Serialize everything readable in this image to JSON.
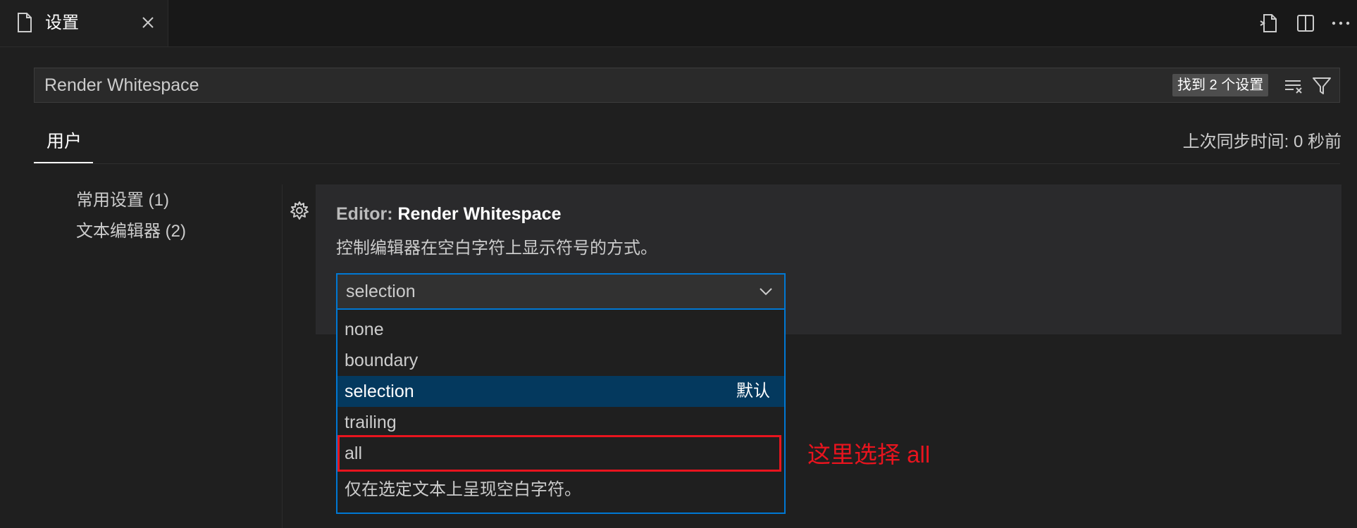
{
  "tab": {
    "title": "设置",
    "icon": "file-icon",
    "close_icon": "close-icon"
  },
  "toolbar": {
    "icons": [
      "open-settings-json-icon",
      "split-editor-icon",
      "more-actions-icon"
    ]
  },
  "search": {
    "value": "Render Whitespace",
    "badge": "找到 2 个设置",
    "icons": [
      "clear-filter-icon",
      "filter-icon"
    ]
  },
  "scope_tab": {
    "label": "用户"
  },
  "sync": {
    "text": "上次同步时间: 0 秒前"
  },
  "toc": {
    "items": [
      {
        "label": "常用设置 (1)"
      },
      {
        "label": "文本编辑器 (2)"
      }
    ]
  },
  "setting": {
    "category": "Editor: ",
    "name": "Render Whitespace",
    "description": "控制编辑器在空白字符上显示符号的方式。",
    "value": "selection",
    "options": [
      {
        "label": "none"
      },
      {
        "label": "boundary"
      },
      {
        "label": "selection",
        "tag": "默认",
        "selected": true
      },
      {
        "label": "trailing"
      },
      {
        "label": "all"
      }
    ],
    "option_description": "仅在选定文本上呈现空白字符。"
  },
  "annotation": {
    "text": "这里选择 all",
    "color": "#e8141e"
  },
  "colors": {
    "accent": "#0078d4",
    "selected_bg": "#04395e",
    "background": "#1f1f1f"
  }
}
